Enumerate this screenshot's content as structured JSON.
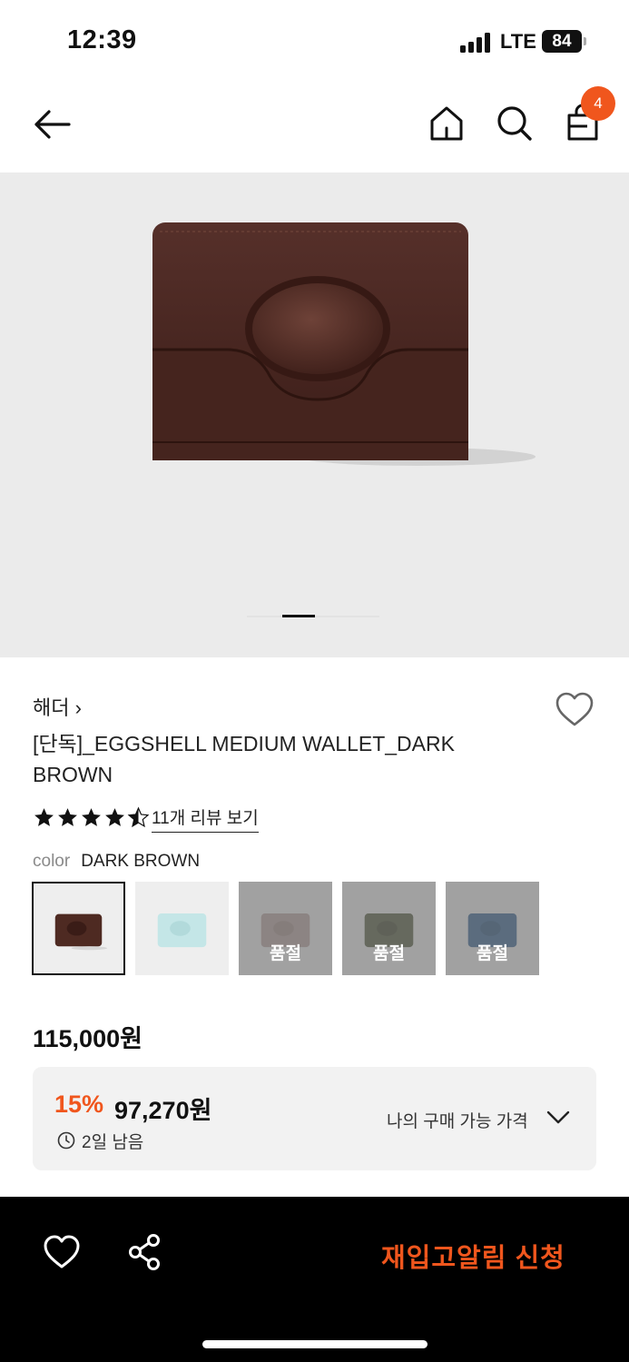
{
  "status_bar": {
    "time": "12:39",
    "network": "LTE",
    "battery": "84"
  },
  "nav": {
    "cart_count": "4",
    "icons": [
      "back-arrow-icon",
      "home-icon",
      "search-icon",
      "shopping-bag-icon"
    ]
  },
  "gallery": {
    "image_label": "dark brown leather wallet",
    "page_index": 2,
    "page_count": 4
  },
  "product": {
    "brand": "해더 ›",
    "title": "[단독]_EGGSHELL MEDIUM WALLET_DARK BROWN",
    "rating": 4.5,
    "review_link": "11개 리뷰 보기",
    "color_label": "color",
    "color_value": "DARK BROWN"
  },
  "swatches": [
    {
      "color": "#4e2a22",
      "selected": true,
      "sold_out": false,
      "badge": ""
    },
    {
      "color": "#c4e6e7",
      "selected": false,
      "sold_out": false,
      "badge": ""
    },
    {
      "color": "#b9a6a2",
      "selected": false,
      "sold_out": true,
      "badge": "품절"
    },
    {
      "color": "#5b6148",
      "selected": false,
      "sold_out": true,
      "badge": "품절"
    },
    {
      "color": "#3f6a96",
      "selected": false,
      "sold_out": true,
      "badge": "품절"
    }
  ],
  "pricing": {
    "original": "115,000원",
    "discount_pct": "15%",
    "discount_price": "97,270원",
    "remaining": "2일 남음",
    "my_price_label": "나의 구매 가능 가격"
  },
  "bottom_bar": {
    "restock_label": "재입고알림 신청"
  },
  "colors": {
    "accent": "#f0561d",
    "hero_bg": "#ebebeb",
    "bar_bg": "#000000"
  }
}
